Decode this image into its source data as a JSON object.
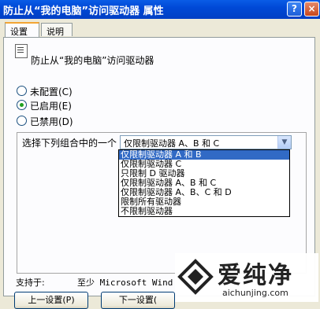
{
  "window": {
    "title": "防止从“我的电脑”访问驱动器 属性",
    "help_glyph": "?",
    "close_glyph": "×"
  },
  "tabs": [
    {
      "label": "设置"
    },
    {
      "label": "说明"
    }
  ],
  "policy": {
    "title": "防止从“我的电脑”访问驱动器",
    "icon": "policy-document-icon"
  },
  "options": [
    {
      "label": "未配置(C)",
      "selected": false
    },
    {
      "label": "已启用(E)",
      "selected": true
    },
    {
      "label": "已禁用(D)",
      "selected": false
    }
  ],
  "combo": {
    "label": "选择下列组合中的一个",
    "value": "仅限制驱动器 A、B 和 C",
    "arrow_glyph": "▼",
    "options": [
      {
        "label": "仅限制驱动器 A 和 B",
        "highlighted": true
      },
      {
        "label": "仅限制驱动器 C",
        "highlighted": false
      },
      {
        "label": "只限制 D 驱动器",
        "highlighted": false
      },
      {
        "label": "仅限制驱动器 A、B 和 C",
        "highlighted": false
      },
      {
        "label": "仅限制驱动器 A、B、C 和 D",
        "highlighted": false
      },
      {
        "label": "限制所有驱动器",
        "highlighted": false
      },
      {
        "label": "不限制驱动器",
        "highlighted": false
      }
    ]
  },
  "supports": {
    "label": "支持于:",
    "value": "至少 Microsoft Wind"
  },
  "buttons": {
    "prev": "上一设置(P)",
    "next": "下一设置("
  },
  "watermark": {
    "text": "爱纯净",
    "url": "aichunjing.com"
  },
  "colors": {
    "titlebar": "#0049d6",
    "selection": "#316ac5",
    "radio_on": "#21a121"
  }
}
